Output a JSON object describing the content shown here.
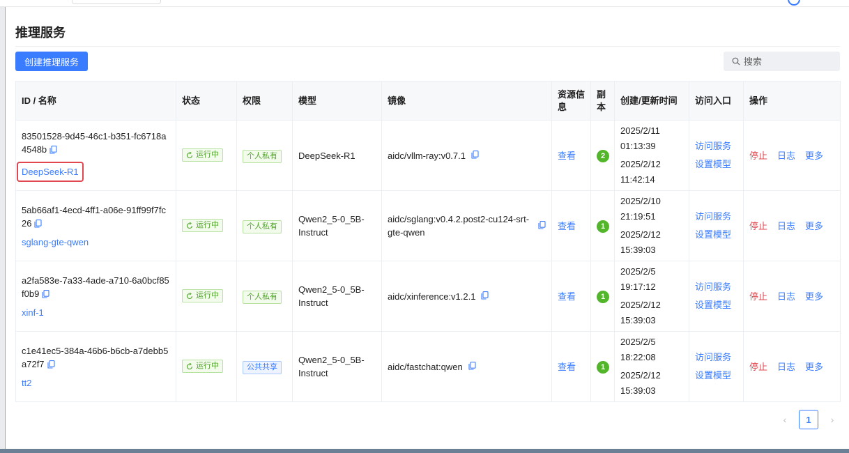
{
  "page": {
    "title": "推理服务"
  },
  "toolbar": {
    "create_label": "创建推理服务",
    "search_placeholder": "搜索"
  },
  "table": {
    "headers": {
      "id_name": "ID / 名称",
      "status": "状态",
      "permission": "权限",
      "model": "模型",
      "image": "镜像",
      "resource": "资源信息",
      "replicas": "副本",
      "time": "创建/更新时间",
      "access": "访问入口",
      "actions": "操作"
    },
    "rows": [
      {
        "id": "83501528-9d45-46c1-b351-fc6718a4548b",
        "name": "DeepSeek-R1",
        "status": "运行中",
        "permission": "个人私有",
        "model": "DeepSeek-R1",
        "image": "aidc/vllm-ray:v0.7.1",
        "resource": "查看",
        "replicas": "2",
        "created": "2025/2/11 01:13:39",
        "updated": "2025/2/12 11:42:14",
        "access_visit": "访问服务",
        "access_set": "设置模型",
        "op_stop": "停止",
        "op_log": "日志",
        "op_more": "更多"
      },
      {
        "id": "5ab66af1-4ecd-4ff1-a06e-91ff99f7fc26",
        "name": "sglang-gte-qwen",
        "status": "运行中",
        "permission": "个人私有",
        "model": "Qwen2_5-0_5B-Instruct",
        "image": "aidc/sglang:v0.4.2.post2-cu124-srt-gte-qwen",
        "resource": "查看",
        "replicas": "1",
        "created": "2025/2/10 21:19:51",
        "updated": "2025/2/12 15:39:03",
        "access_visit": "访问服务",
        "access_set": "设置模型",
        "op_stop": "停止",
        "op_log": "日志",
        "op_more": "更多"
      },
      {
        "id": "a2fa583e-7a33-4ade-a710-6a0bcf85f0b9",
        "name": "xinf-1",
        "status": "运行中",
        "permission": "个人私有",
        "model": "Qwen2_5-0_5B-Instruct",
        "image": "aidc/xinference:v1.2.1",
        "resource": "查看",
        "replicas": "1",
        "created": "2025/2/5 19:17:12",
        "updated": "2025/2/12 15:39:03",
        "access_visit": "访问服务",
        "access_set": "设置模型",
        "op_stop": "停止",
        "op_log": "日志",
        "op_more": "更多"
      },
      {
        "id": "c1e41ec5-384a-46b6-b6cb-a7debb5a72f7",
        "name": "tt2",
        "status": "运行中",
        "permission": "公共共享",
        "model": "Qwen2_5-0_5B-Instruct",
        "image": "aidc/fastchat:qwen",
        "resource": "查看",
        "replicas": "1",
        "created": "2025/2/5 18:22:08",
        "updated": "2025/2/12 15:39:03",
        "access_visit": "访问服务",
        "access_set": "设置模型",
        "op_stop": "停止",
        "op_log": "日志",
        "op_more": "更多"
      }
    ]
  },
  "pagination": {
    "current": "1",
    "prev": "‹",
    "next": "›"
  },
  "colors": {
    "primary": "#3a7cff",
    "danger": "#e0474f",
    "success": "#52b52a"
  },
  "icons": {
    "copy": "copy-icon",
    "search": "search-icon",
    "refresh": "refresh-icon"
  }
}
